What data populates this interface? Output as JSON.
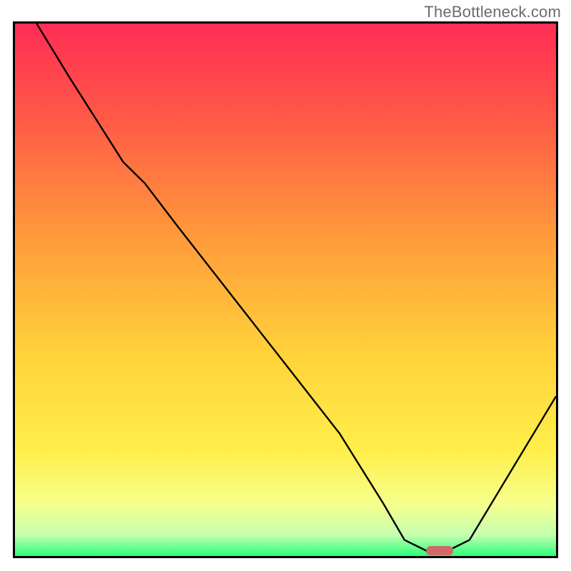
{
  "watermark": "TheBottleneck.com",
  "chart_data": {
    "type": "line",
    "title": "",
    "xlabel": "",
    "ylabel": "",
    "xlim": [
      0,
      100
    ],
    "ylim": [
      0,
      100
    ],
    "grid": false,
    "legend": false,
    "series": [
      {
        "name": "bottleneck-curve",
        "x": [
          4,
          10,
          20,
          24,
          30,
          40,
          50,
          60,
          68,
          72,
          76,
          80,
          84,
          100
        ],
        "y": [
          100,
          90,
          74,
          70,
          62,
          49,
          36,
          23,
          10,
          3,
          1,
          1,
          3,
          30
        ]
      }
    ],
    "marker": {
      "name": "optimal-range",
      "x_start": 76,
      "x_end": 81,
      "y": 1
    },
    "gradient_stops": [
      {
        "offset": 0.0,
        "color": "#ff2c55"
      },
      {
        "offset": 0.18,
        "color": "#ff5a46"
      },
      {
        "offset": 0.4,
        "color": "#ff9a3b"
      },
      {
        "offset": 0.62,
        "color": "#ffd23a"
      },
      {
        "offset": 0.8,
        "color": "#ffee4a"
      },
      {
        "offset": 0.9,
        "color": "#f6ff8a"
      },
      {
        "offset": 0.96,
        "color": "#c6ffb0"
      },
      {
        "offset": 1.0,
        "color": "#2bff7a"
      }
    ]
  }
}
